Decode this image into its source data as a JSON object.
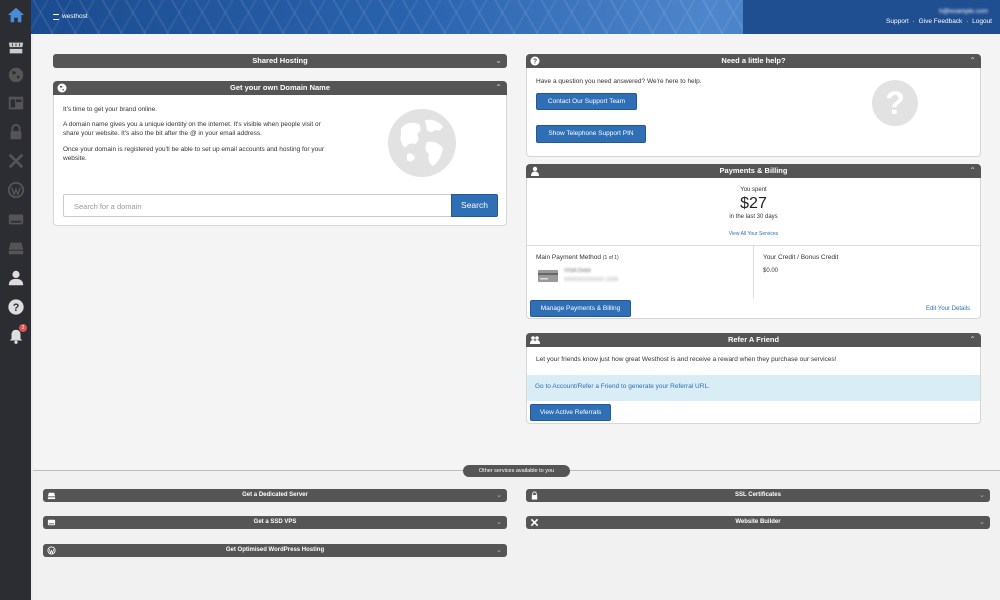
{
  "header": {
    "logo_text": "westhost",
    "user_email": "h@example.com",
    "links": [
      "Support",
      "Give Feedback",
      "Logout"
    ],
    "link_sep": "·"
  },
  "shared_hosting": {
    "title": "Shared Hosting"
  },
  "domain": {
    "title": "Get your own Domain Name",
    "intro": "It's time to get your brand online.",
    "para1": "A domain name gives you a unique identity on the internet. It's visible when people visit or share your website. It's also the bit after the @ in your email address.",
    "para2": "Once your domain is registered you'll be able to set up email accounts and hosting for your website.",
    "search_placeholder": "Search for a domain",
    "search_button": "Search"
  },
  "help": {
    "title": "Need a little help?",
    "text": "Have a question you need answered? We're here to help.",
    "contact_button": "Contact Our Support Team",
    "pin_button": "Show Telephone Support PIN"
  },
  "billing": {
    "title": "Payments & Billing",
    "you_spent": "You spent",
    "amount": "$27",
    "period": "in the last 30 days",
    "view_all": "View All Your Services",
    "main_method_label": "Main Payment Method",
    "method_count": "(1 of 1)",
    "card_name": "VISA Debit",
    "card_details": "XXXXXXXXXXXX 12/24",
    "credit_label": "Your Credit / Bonus Credit",
    "credit_value": "$0.00",
    "manage_button": "Manage Payments & Billing",
    "edit_link": "Edit Your Details"
  },
  "refer": {
    "title": "Refer A Friend",
    "text": "Let your friends know just how great Westhost is and receive a reward when they purchase our services!",
    "link_text": "Go to Account/Refer a Friend to generate your Referral URL.",
    "button": "View Active Referrals"
  },
  "other_services": {
    "label": "Other services available to you",
    "items": [
      "Get a Dedicated Server",
      "SSL Certificates",
      "Get a SSD VPS",
      "Website Builder",
      "Get Optimised WordPress Hosting"
    ]
  },
  "notifications": {
    "count": "2"
  },
  "colors": {
    "accent": "#2e6fb5",
    "header_bar": "#555555",
    "sidebar": "#2b2d33"
  }
}
